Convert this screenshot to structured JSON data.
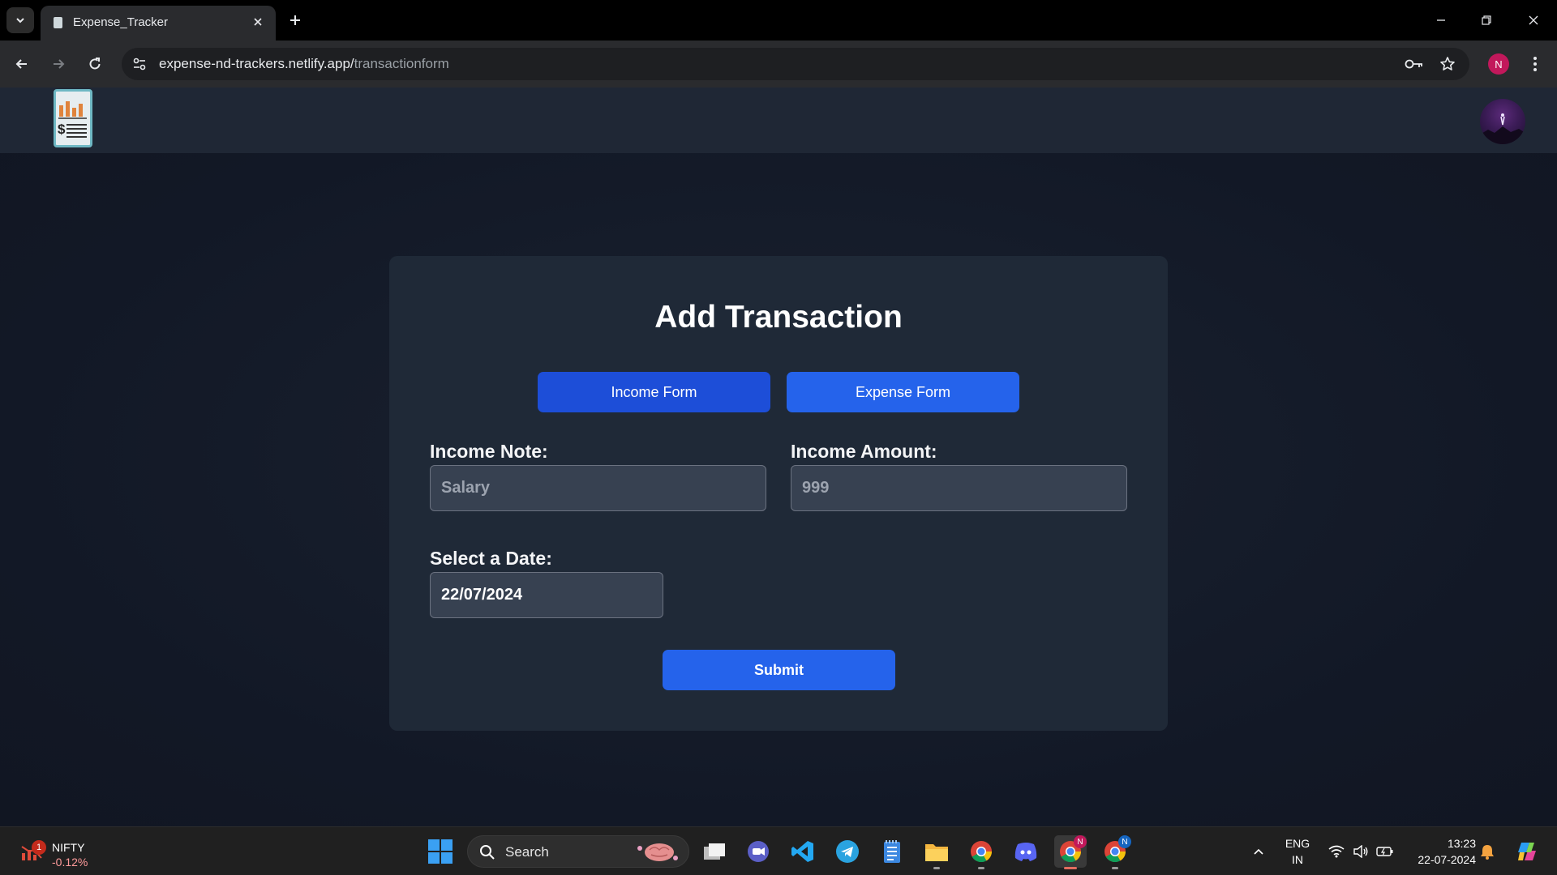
{
  "browser": {
    "tab_title": "Expense_Tracker",
    "url_host": "expense-nd-trackers.netlify.app/",
    "url_path": "transactionform",
    "profile_initial": "N"
  },
  "page": {
    "title": "Add Transaction",
    "income_form_label": "Income Form",
    "expense_form_label": "Expense Form",
    "income_note_label": "Income Note:",
    "income_note_placeholder": "Salary",
    "income_amount_label": "Income Amount:",
    "income_amount_placeholder": "999",
    "date_label": "Select a Date:",
    "date_value": "22/07/2024",
    "submit_label": "Submit"
  },
  "colors": {
    "card_background": "#1f2937",
    "primary_button": "#2563eb",
    "active_form_button": "#1d4ed8"
  },
  "taskbar": {
    "widget_name": "NIFTY",
    "widget_value": "-0.12%",
    "widget_badge": "1",
    "search_label": "Search",
    "language_line1": "ENG",
    "language_line2": "IN",
    "time": "13:23",
    "date": "22-07-2024",
    "chrome_badge_1": "N",
    "chrome_badge_2": "N"
  }
}
